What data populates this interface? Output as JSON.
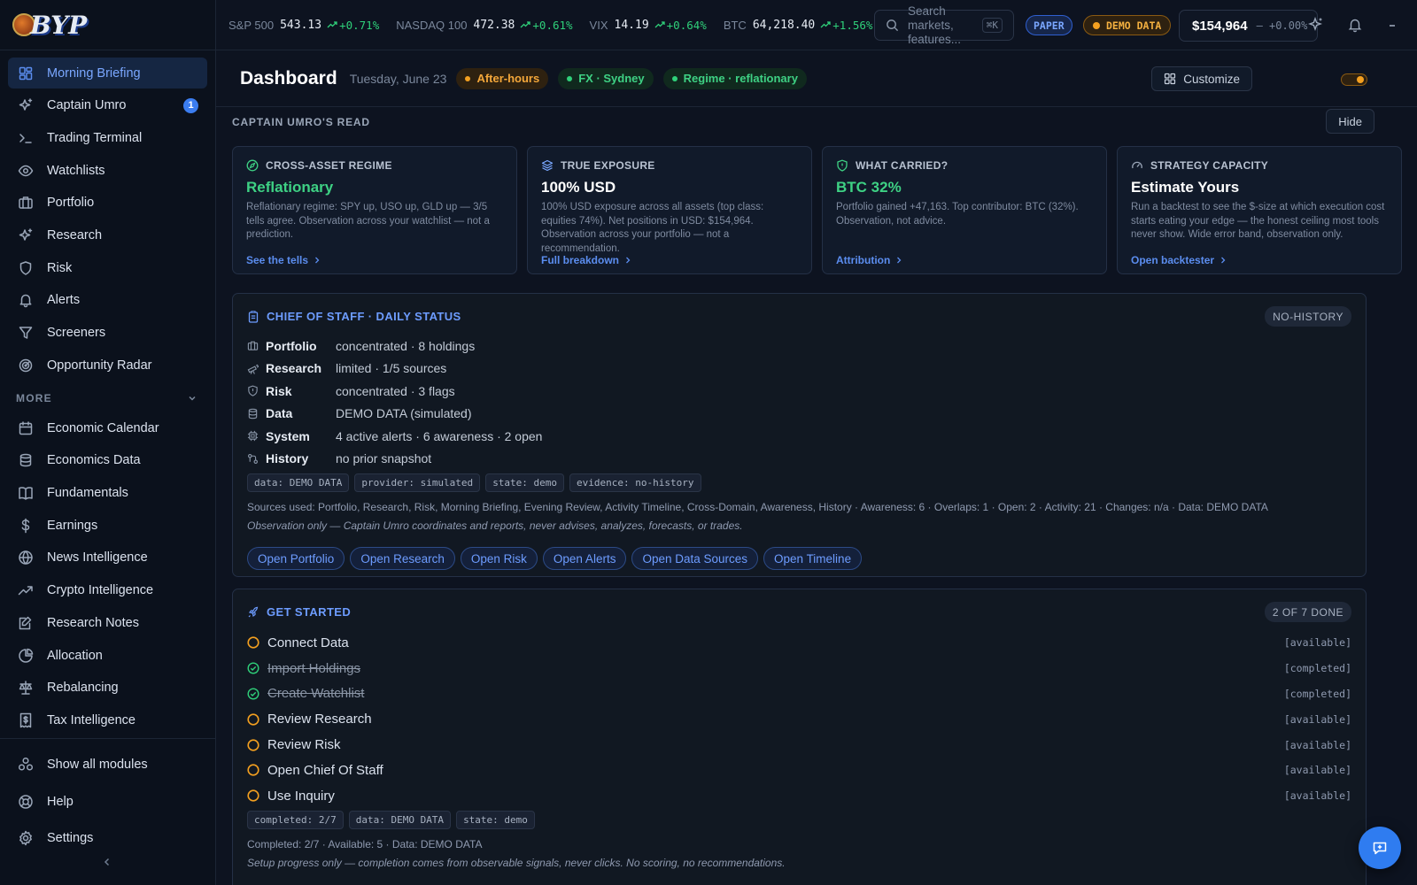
{
  "app": {
    "logo_text": "BYP"
  },
  "sidebar": {
    "items": [
      {
        "label": "Morning Briefing",
        "icon": "dashboard-icon",
        "active": true
      },
      {
        "label": "Captain Umro",
        "icon": "sparkles-icon",
        "badge": "1"
      },
      {
        "label": "Trading Terminal",
        "icon": "terminal-icon"
      },
      {
        "label": "Watchlists",
        "icon": "eye-icon"
      },
      {
        "label": "Portfolio",
        "icon": "briefcase-icon"
      },
      {
        "label": "Research",
        "icon": "sparkles-icon"
      },
      {
        "label": "Risk",
        "icon": "shield-icon"
      },
      {
        "label": "Alerts",
        "icon": "bell-icon"
      },
      {
        "label": "Screeners",
        "icon": "filter-icon"
      },
      {
        "label": "Opportunity Radar",
        "icon": "radar-icon"
      }
    ],
    "more_label": "MORE",
    "more_items": [
      {
        "label": "Economic Calendar",
        "icon": "calendar-icon"
      },
      {
        "label": "Economics Data",
        "icon": "database-icon"
      },
      {
        "label": "Fundamentals",
        "icon": "book-icon"
      },
      {
        "label": "Earnings",
        "icon": "dollar-icon"
      },
      {
        "label": "News Intelligence",
        "icon": "globe-icon"
      },
      {
        "label": "Crypto Intelligence",
        "icon": "trending-icon"
      },
      {
        "label": "Research Notes",
        "icon": "notes-icon"
      },
      {
        "label": "Allocation",
        "icon": "pie-icon"
      },
      {
        "label": "Rebalancing",
        "icon": "scale-icon"
      },
      {
        "label": "Tax Intelligence",
        "icon": "receipt-icon"
      }
    ],
    "bottom_items": [
      {
        "label": "Show all modules",
        "icon": "modules-icon"
      },
      {
        "label": "Help",
        "icon": "lifebuoy-icon"
      },
      {
        "label": "Settings",
        "icon": "gear-icon"
      }
    ]
  },
  "ticker": [
    {
      "symbol": "S&P 500",
      "value": "543.13",
      "change": "+0.71%"
    },
    {
      "symbol": "NASDAQ 100",
      "value": "472.38",
      "change": "+0.61%"
    },
    {
      "symbol": "VIX",
      "value": "14.19",
      "change": "+0.64%"
    },
    {
      "symbol": "BTC",
      "value": "64,218.40",
      "change": "+1.56%"
    }
  ],
  "topbar": {
    "search_placeholder": "Search markets, features...",
    "search_shortcut": "⌘K",
    "paper_label": "PAPER",
    "demo_label": "DEMO DATA",
    "balance": "$154,964",
    "balance_change": "+0.00%"
  },
  "header": {
    "title": "Dashboard",
    "date": "Tuesday, June 23",
    "chips": [
      "After-hours",
      "FX · Sydney",
      "Regime · reflationary"
    ],
    "customize_label": "Customize"
  },
  "read": {
    "title": "CAPTAIN UMRO'S READ",
    "hide_label": "Hide",
    "cards": [
      {
        "kicker": "CROSS-ASSET REGIME",
        "value": "Reflationary",
        "desc": "Reflationary regime: SPY up, USO up, GLD up — 3/5 tells agree. Observation across your watchlist — not a prediction.",
        "link": "See the tells"
      },
      {
        "kicker": "TRUE EXPOSURE",
        "value": "100% USD",
        "desc": "100% USD exposure across all assets (top class: equities 74%). Net positions in USD: $154,964. Observation across your portfolio — not a recommendation.",
        "link": "Full breakdown"
      },
      {
        "kicker": "WHAT CARRIED?",
        "value": "BTC 32%",
        "desc": "Portfolio gained +47,163. Top contributor: BTC (32%). Observation, not advice.",
        "link": "Attribution"
      },
      {
        "kicker": "STRATEGY CAPACITY",
        "value": "Estimate Yours",
        "desc": "Run a backtest to see the $-size at which execution cost starts eating your edge — the honest ceiling most tools never show. Wide error band, observation only.",
        "link": "Open backtester"
      }
    ]
  },
  "cos": {
    "title": "CHIEF OF STAFF · DAILY STATUS",
    "tag": "NO-HISTORY",
    "rows": [
      {
        "key": "Portfolio",
        "value": "concentrated · 8 holdings"
      },
      {
        "key": "Research",
        "value": "limited · 1/5 sources"
      },
      {
        "key": "Risk",
        "value": "concentrated · 3 flags"
      },
      {
        "key": "Data",
        "value": "DEMO DATA (simulated)"
      },
      {
        "key": "System",
        "value": "4 active alerts · 6 awareness · 2 open"
      },
      {
        "key": "History",
        "value": "no prior snapshot"
      }
    ],
    "tags": [
      "data: DEMO DATA",
      "provider: simulated",
      "state: demo",
      "evidence: no-history"
    ],
    "sources": "Sources used: Portfolio, Research, Risk, Morning Briefing, Evening Review, Activity Timeline, Cross-Domain, Awareness, History · Awareness: 6 · Overlaps: 1 · Open: 2 · Activity: 21 · Changes: n/a · Data: DEMO DATA",
    "note": "Observation only — Captain Umro coordinates and reports, never advises, analyzes, forecasts, or trades.",
    "buttons": [
      "Open Portfolio",
      "Open Research",
      "Open Risk",
      "Open Alerts",
      "Open Data Sources",
      "Open Timeline"
    ]
  },
  "getstarted": {
    "title": "GET STARTED",
    "tag": "2 OF 7 DONE",
    "steps": [
      {
        "label": "Connect Data",
        "state": "[available]",
        "done": false
      },
      {
        "label": "Import Holdings",
        "state": "[completed]",
        "done": true
      },
      {
        "label": "Create Watchlist",
        "state": "[completed]",
        "done": true
      },
      {
        "label": "Review Research",
        "state": "[available]",
        "done": false
      },
      {
        "label": "Review Risk",
        "state": "[available]",
        "done": false
      },
      {
        "label": "Open Chief Of Staff",
        "state": "[available]",
        "done": false
      },
      {
        "label": "Use Inquiry",
        "state": "[available]",
        "done": false
      }
    ],
    "tags": [
      "completed: 2/7",
      "data: DEMO DATA",
      "state: demo"
    ],
    "summary": "Completed: 2/7 · Available: 5 · Data: DEMO DATA",
    "note": "Setup progress only — completion comes from observable signals, never clicks. No scoring, no recommendations."
  },
  "colors": {
    "accent": "#5b8def",
    "positive": "#2fd07a",
    "warning": "#f4a020"
  }
}
